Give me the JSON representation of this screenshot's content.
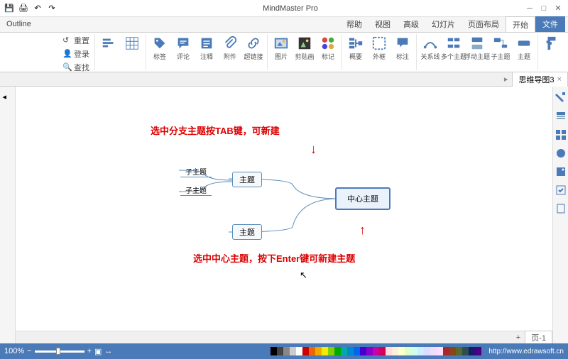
{
  "app": {
    "title": "MindMaster Pro"
  },
  "tabs": {
    "file": "文件",
    "home": "开始",
    "layout": "页面布局",
    "slideshow": "幻灯片",
    "advanced": "高级",
    "view": "视图",
    "help": "帮助",
    "outline": "Outline"
  },
  "ribbon": {
    "topic": "主题",
    "subtopic": "子主题",
    "floating": "浮动主题",
    "multiple": "多个主题",
    "relation": "关系线",
    "callout": "标注",
    "boundary": "外框",
    "summary": "概要",
    "mark": "标记",
    "clipart": "剪贴画",
    "picture": "图片",
    "hyperlink": "超链接",
    "attachment": "附件",
    "note": "注释",
    "comment": "评论",
    "tag": "标签",
    "reset": "重置",
    "font": "登录",
    "number": "查找"
  },
  "doc": {
    "name": "思维导图3"
  },
  "canvas": {
    "central": "中心主题",
    "topic1": "主题",
    "topic2": "主题",
    "sub1": "子主题",
    "sub2": "子主题",
    "hint_top": "选中分支主题按TAB键，可新建",
    "hint_bottom": "选中中心主题，按下Enter键可新建主题"
  },
  "status": {
    "url": "http://www.edrawsoft.cn",
    "zoom": "100%",
    "page_label": "页-1"
  },
  "palette": [
    "#000",
    "#444",
    "#888",
    "#ccc",
    "#fff",
    "#c00",
    "#e60",
    "#ea0",
    "#ee0",
    "#8c0",
    "#0a0",
    "#0aa",
    "#08c",
    "#06e",
    "#40c",
    "#80c",
    "#c0a",
    "#c05",
    "#fdd",
    "#fed",
    "#ffc",
    "#dfc",
    "#cfe",
    "#cef",
    "#ddf",
    "#edf",
    "#fdf",
    "#a52a2a",
    "#8b4513",
    "#556b2f",
    "#2f4f4f",
    "#191970",
    "#4b0082"
  ]
}
